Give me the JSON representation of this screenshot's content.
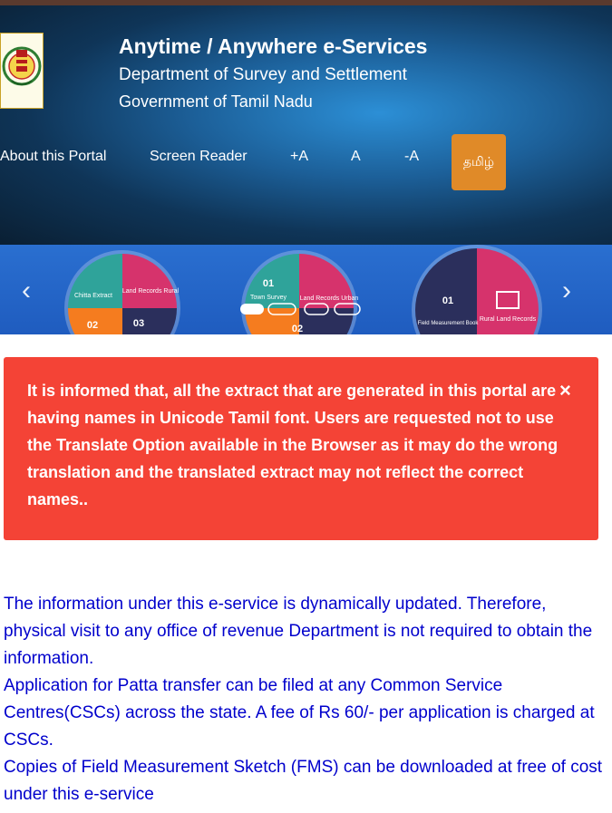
{
  "header": {
    "title": "Anytime / Anywhere e-Services",
    "subtitle1": "Department of Survey and Settlement",
    "subtitle2": "Government of Tamil Nadu",
    "nav": [
      {
        "label": "About this Portal"
      },
      {
        "label": "Screen Reader"
      },
      {
        "label": "+A"
      },
      {
        "label": "A"
      },
      {
        "label": "-A"
      }
    ],
    "language_button": "தமிழ்"
  },
  "carousel": {
    "slides": [
      {
        "labels": [
          "Chitta Extract",
          "Land Records Rural",
          "02",
          "03"
        ]
      },
      {
        "labels": [
          "01",
          "Town Survey",
          "Land Records Urban",
          "02"
        ]
      },
      {
        "labels": [
          "01",
          "Field Measurement Book",
          "Rural Land Records"
        ]
      }
    ],
    "prev_icon": "chevron-left-icon",
    "next_icon": "chevron-right-icon"
  },
  "alert": {
    "message": "It is informed that, all the extract that are generated in this portal are having names in Unicode Tamil font. Users are requested not to use the Translate Option available in the Browser as it may do the wrong translation and the translated extract may not reflect the correct names..",
    "close": "×"
  },
  "info": [
    "The information under this e-service is dynamically updated. Therefore, physical visit to any office of revenue Department is not required to obtain the information.",
    "Application for Patta transfer can be filed at any Common Service Centres(CSCs) across the state. A fee of Rs 60/- per application is charged at CSCs.",
    "Copies of Field Measurement Sketch (FMS) can be downloaded at free of cost under this e-service"
  ],
  "colors": {
    "alert_bg": "#f44336",
    "language_button_bg": "#e08a28",
    "info_text": "#0000cc"
  }
}
